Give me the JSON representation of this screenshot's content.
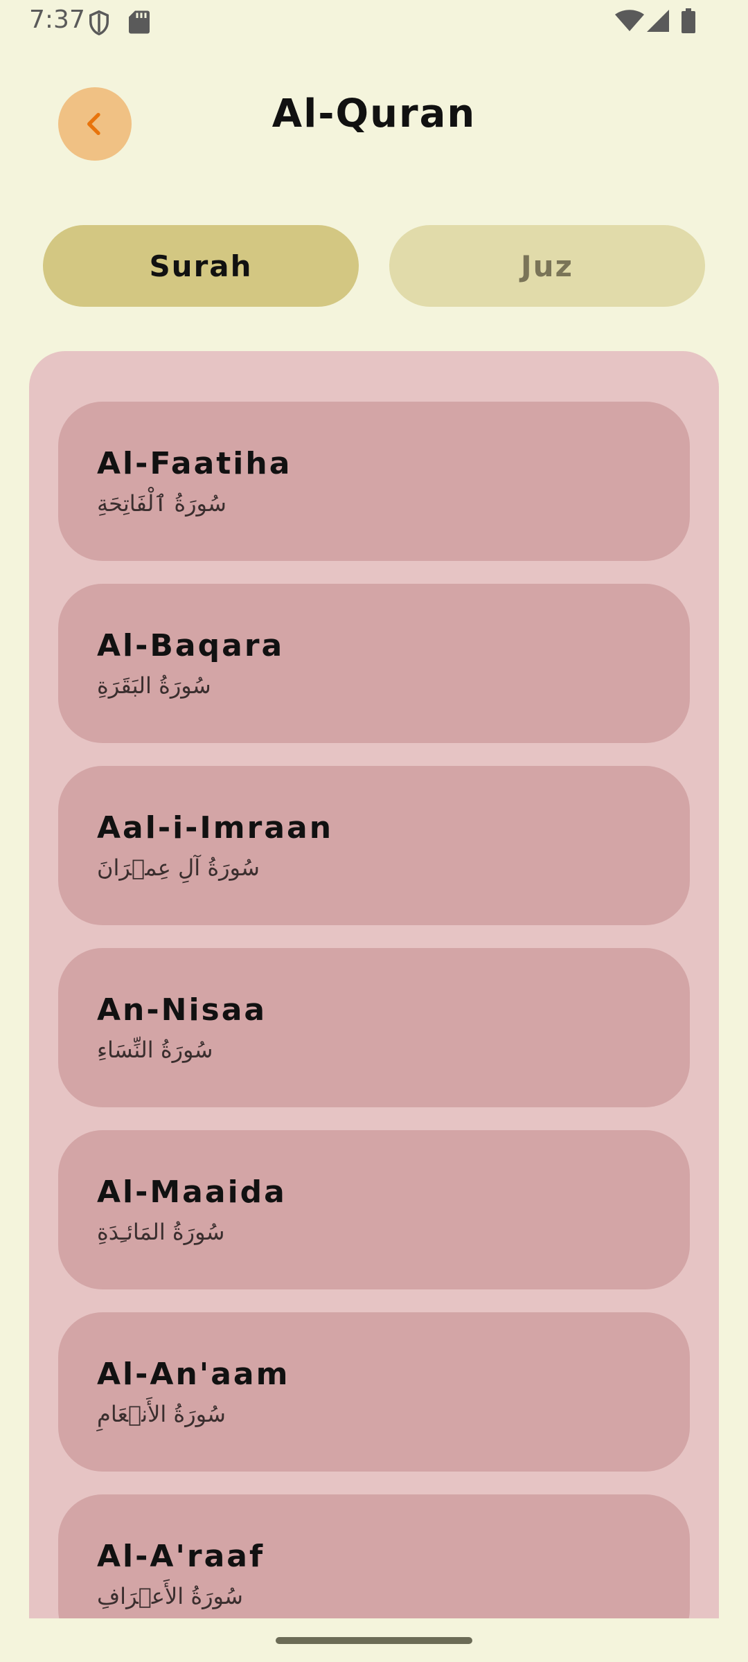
{
  "status_bar": {
    "time": "7:37",
    "icons": [
      "shield-icon",
      "sd-card-icon",
      "wifi-icon",
      "signal-icon",
      "battery-icon"
    ]
  },
  "header": {
    "title": "Al-Quran",
    "back_icon": "chevron-left-icon",
    "back_color": "#f0c184",
    "back_icon_color": "#e8740c"
  },
  "tabs": [
    {
      "label": "Surah",
      "selected": true
    },
    {
      "label": "Juz",
      "selected": false
    }
  ],
  "surahs": [
    {
      "name": "Al-Faatiha",
      "arabic": "سُورَةُ ٱلْفَاتِحَةِ"
    },
    {
      "name": "Al-Baqara",
      "arabic": "سُورَةُ البَقَرَةِ"
    },
    {
      "name": "Aal-i-Imraan",
      "arabic": "سُورَةُ آلِ عِمۡرَانَ"
    },
    {
      "name": "An-Nisaa",
      "arabic": "سُورَةُ النِّسَاءِ"
    },
    {
      "name": "Al-Maaida",
      "arabic": "سُورَةُ المَائـِدَةِ"
    },
    {
      "name": "Al-An'aam",
      "arabic": "سُورَةُ الأَنۡعَامِ"
    },
    {
      "name": "Al-A'raaf",
      "arabic": "سُورَةُ الأَعۡرَافِ"
    }
  ],
  "colors": {
    "background": "#f4f4dc",
    "tab_selected": "#d3c782",
    "tab_unselected": "#e1dbaa",
    "panel": "#e6c4c4",
    "card": "#d3a5a6"
  }
}
